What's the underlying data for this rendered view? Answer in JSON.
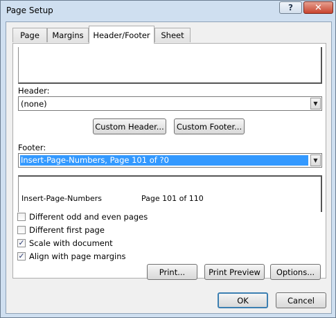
{
  "window": {
    "title": "Page Setup",
    "help_glyph": "?",
    "close_glyph": "✕"
  },
  "tabs": [
    {
      "label": "Page"
    },
    {
      "label": "Margins"
    },
    {
      "label": "Header/Footer"
    },
    {
      "label": "Sheet"
    }
  ],
  "header": {
    "label": "Header:",
    "value": "(none)"
  },
  "buttons": {
    "custom_header": "Custom Header...",
    "custom_footer": "Custom Footer...",
    "print": "Print...",
    "print_preview": "Print Preview",
    "options": "Options...",
    "ok": "OK",
    "cancel": "Cancel"
  },
  "footer": {
    "label": "Footer:",
    "value": "Insert-Page-Numbers, Page 101 of ?0",
    "preview_left": "Insert-Page-Numbers",
    "preview_center": "Page 101 of 110"
  },
  "options": [
    {
      "label": "Different odd and even pages",
      "checked": false
    },
    {
      "label": "Different first page",
      "checked": false
    },
    {
      "label": "Scale with document",
      "checked": true
    },
    {
      "label": "Align with page margins",
      "checked": true
    }
  ],
  "check_glyph": "✓",
  "dropdown_glyph": "▼"
}
